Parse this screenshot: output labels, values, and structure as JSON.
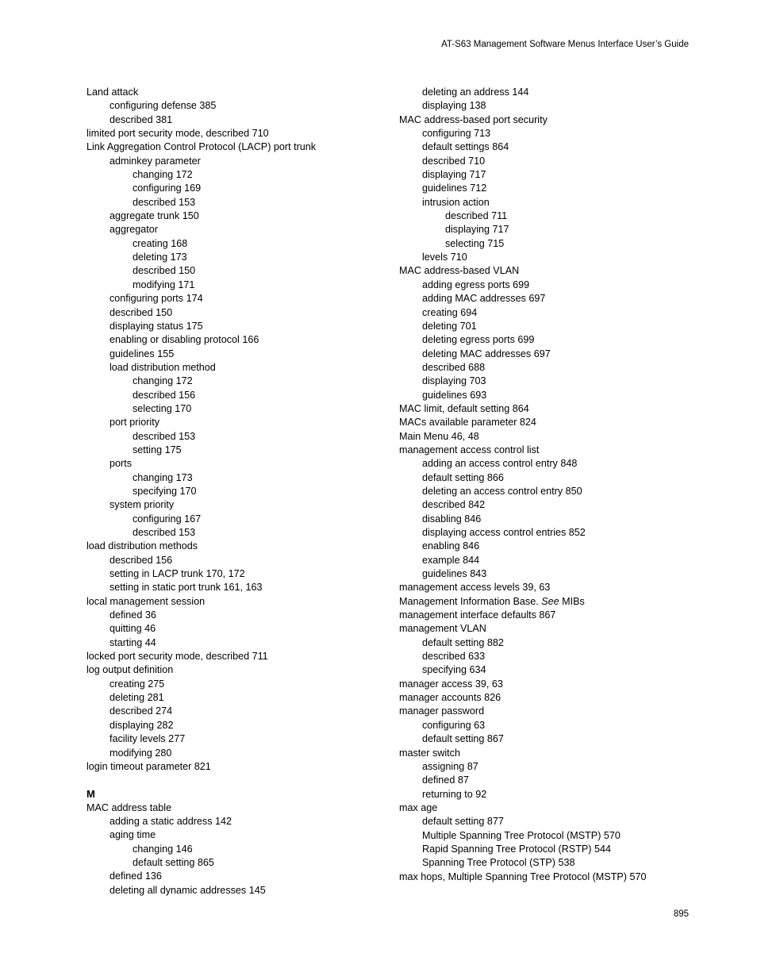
{
  "header": {
    "running_head": "AT-S63 Management Software Menus Interface User’s Guide"
  },
  "footer": {
    "page_number": "895"
  },
  "index": {
    "left_column": [
      {
        "level": 0,
        "text": "Land attack"
      },
      {
        "level": 1,
        "text": "configuring defense 385"
      },
      {
        "level": 1,
        "text": "described 381"
      },
      {
        "level": 0,
        "text": "limited port security mode, described 710"
      },
      {
        "level": 0,
        "text": "Link Aggregation Control Protocol (LACP) port trunk"
      },
      {
        "level": 1,
        "text": "adminkey parameter"
      },
      {
        "level": 2,
        "text": "changing 172"
      },
      {
        "level": 2,
        "text": "configuring 169"
      },
      {
        "level": 2,
        "text": "described 153"
      },
      {
        "level": 1,
        "text": "aggregate trunk 150"
      },
      {
        "level": 1,
        "text": "aggregator"
      },
      {
        "level": 2,
        "text": "creating 168"
      },
      {
        "level": 2,
        "text": "deleting 173"
      },
      {
        "level": 2,
        "text": "described 150"
      },
      {
        "level": 2,
        "text": "modifying 171"
      },
      {
        "level": 1,
        "text": "configuring ports 174"
      },
      {
        "level": 1,
        "text": "described 150"
      },
      {
        "level": 1,
        "text": "displaying status 175"
      },
      {
        "level": 1,
        "text": "enabling or disabling protocol 166"
      },
      {
        "level": 1,
        "text": "guidelines 155"
      },
      {
        "level": 1,
        "text": "load distribution method"
      },
      {
        "level": 2,
        "text": "changing 172"
      },
      {
        "level": 2,
        "text": "described 156"
      },
      {
        "level": 2,
        "text": "selecting 170"
      },
      {
        "level": 1,
        "text": "port priority"
      },
      {
        "level": 2,
        "text": "described 153"
      },
      {
        "level": 2,
        "text": "setting 175"
      },
      {
        "level": 1,
        "text": "ports"
      },
      {
        "level": 2,
        "text": "changing 173"
      },
      {
        "level": 2,
        "text": "specifying 170"
      },
      {
        "level": 1,
        "text": "system priority"
      },
      {
        "level": 2,
        "text": "configuring 167"
      },
      {
        "level": 2,
        "text": "described 153"
      },
      {
        "level": 0,
        "text": "load distribution methods"
      },
      {
        "level": 1,
        "text": "described 156"
      },
      {
        "level": 1,
        "text": "setting in LACP trunk 170, 172"
      },
      {
        "level": 1,
        "text": "setting in static port trunk 161, 163"
      },
      {
        "level": 0,
        "text": "local management session"
      },
      {
        "level": 1,
        "text": "defined 36"
      },
      {
        "level": 1,
        "text": "quitting 46"
      },
      {
        "level": 1,
        "text": "starting 44"
      },
      {
        "level": 0,
        "text": "locked port security mode, described 711"
      },
      {
        "level": 0,
        "text": "log output definition"
      },
      {
        "level": 1,
        "text": "creating 275"
      },
      {
        "level": 1,
        "text": "deleting 281"
      },
      {
        "level": 1,
        "text": "described 274"
      },
      {
        "level": 1,
        "text": "displaying 282"
      },
      {
        "level": 1,
        "text": "facility levels 277"
      },
      {
        "level": 1,
        "text": "modifying 280"
      },
      {
        "level": 0,
        "text": "login timeout parameter 821"
      },
      {
        "level": 0,
        "heading": "M"
      },
      {
        "level": 0,
        "text": "MAC address table"
      },
      {
        "level": 1,
        "text": "adding a static address 142"
      },
      {
        "level": 1,
        "text": "aging time"
      },
      {
        "level": 2,
        "text": "changing 146"
      },
      {
        "level": 2,
        "text": "default setting 865"
      },
      {
        "level": 1,
        "text": "defined 136"
      },
      {
        "level": 1,
        "text": "deleting all dynamic addresses 145"
      }
    ],
    "right_column": [
      {
        "level": 1,
        "text": "deleting an address 144"
      },
      {
        "level": 1,
        "text": "displaying 138"
      },
      {
        "level": 0,
        "text": "MAC address-based port security"
      },
      {
        "level": 1,
        "text": "configuring 713"
      },
      {
        "level": 1,
        "text": "default settings 864"
      },
      {
        "level": 1,
        "text": "described 710"
      },
      {
        "level": 1,
        "text": "displaying 717"
      },
      {
        "level": 1,
        "text": "guidelines 712"
      },
      {
        "level": 1,
        "text": "intrusion action"
      },
      {
        "level": 2,
        "text": "described 711"
      },
      {
        "level": 2,
        "text": "displaying 717"
      },
      {
        "level": 2,
        "text": "selecting 715"
      },
      {
        "level": 1,
        "text": "levels 710"
      },
      {
        "level": 0,
        "text": "MAC address-based VLAN"
      },
      {
        "level": 1,
        "text": "adding egress ports 699"
      },
      {
        "level": 1,
        "text": "adding MAC addresses 697"
      },
      {
        "level": 1,
        "text": "creating 694"
      },
      {
        "level": 1,
        "text": "deleting 701"
      },
      {
        "level": 1,
        "text": "deleting egress ports 699"
      },
      {
        "level": 1,
        "text": "deleting MAC addresses 697"
      },
      {
        "level": 1,
        "text": "described 688"
      },
      {
        "level": 1,
        "text": "displaying 703"
      },
      {
        "level": 1,
        "text": "guidelines 693"
      },
      {
        "level": 0,
        "text": "MAC limit, default setting 864"
      },
      {
        "level": 0,
        "text": "MACs available parameter 824"
      },
      {
        "level": 0,
        "text": "Main Menu 46, 48"
      },
      {
        "level": 0,
        "text": "management access control list"
      },
      {
        "level": 1,
        "text": "adding an access control entry 848"
      },
      {
        "level": 1,
        "text": "default setting 866"
      },
      {
        "level": 1,
        "text": "deleting an access control entry 850"
      },
      {
        "level": 1,
        "text": "described 842"
      },
      {
        "level": 1,
        "text": "disabling 846"
      },
      {
        "level": 1,
        "text": "displaying access control entries 852"
      },
      {
        "level": 1,
        "text": "enabling 846"
      },
      {
        "level": 1,
        "text": "example 844"
      },
      {
        "level": 1,
        "text": "guidelines 843"
      },
      {
        "level": 0,
        "text": "management access levels 39, 63"
      },
      {
        "level": 0,
        "html": "Management Information Base. <em>See</em> MIBs"
      },
      {
        "level": 0,
        "text": "management interface defaults 867"
      },
      {
        "level": 0,
        "text": "management VLAN"
      },
      {
        "level": 1,
        "text": "default setting 882"
      },
      {
        "level": 1,
        "text": "described 633"
      },
      {
        "level": 1,
        "text": "specifying 634"
      },
      {
        "level": 0,
        "text": "manager access 39, 63"
      },
      {
        "level": 0,
        "text": "manager accounts 826"
      },
      {
        "level": 0,
        "text": "manager password"
      },
      {
        "level": 1,
        "text": "configuring 63"
      },
      {
        "level": 1,
        "text": "default setting 867"
      },
      {
        "level": 0,
        "text": "master switch"
      },
      {
        "level": 1,
        "text": "assigning 87"
      },
      {
        "level": 1,
        "text": "defined 87"
      },
      {
        "level": 1,
        "text": "returning to 92"
      },
      {
        "level": 0,
        "text": "max age"
      },
      {
        "level": 1,
        "text": "default setting 877"
      },
      {
        "level": 1,
        "text": "Multiple Spanning Tree Protocol (MSTP) 570"
      },
      {
        "level": 1,
        "text": "Rapid Spanning Tree Protocol (RSTP) 544"
      },
      {
        "level": 1,
        "text": "Spanning Tree Protocol (STP) 538"
      },
      {
        "level": 0,
        "text": "max hops, Multiple Spanning Tree Protocol (MSTP) 570"
      }
    ]
  }
}
